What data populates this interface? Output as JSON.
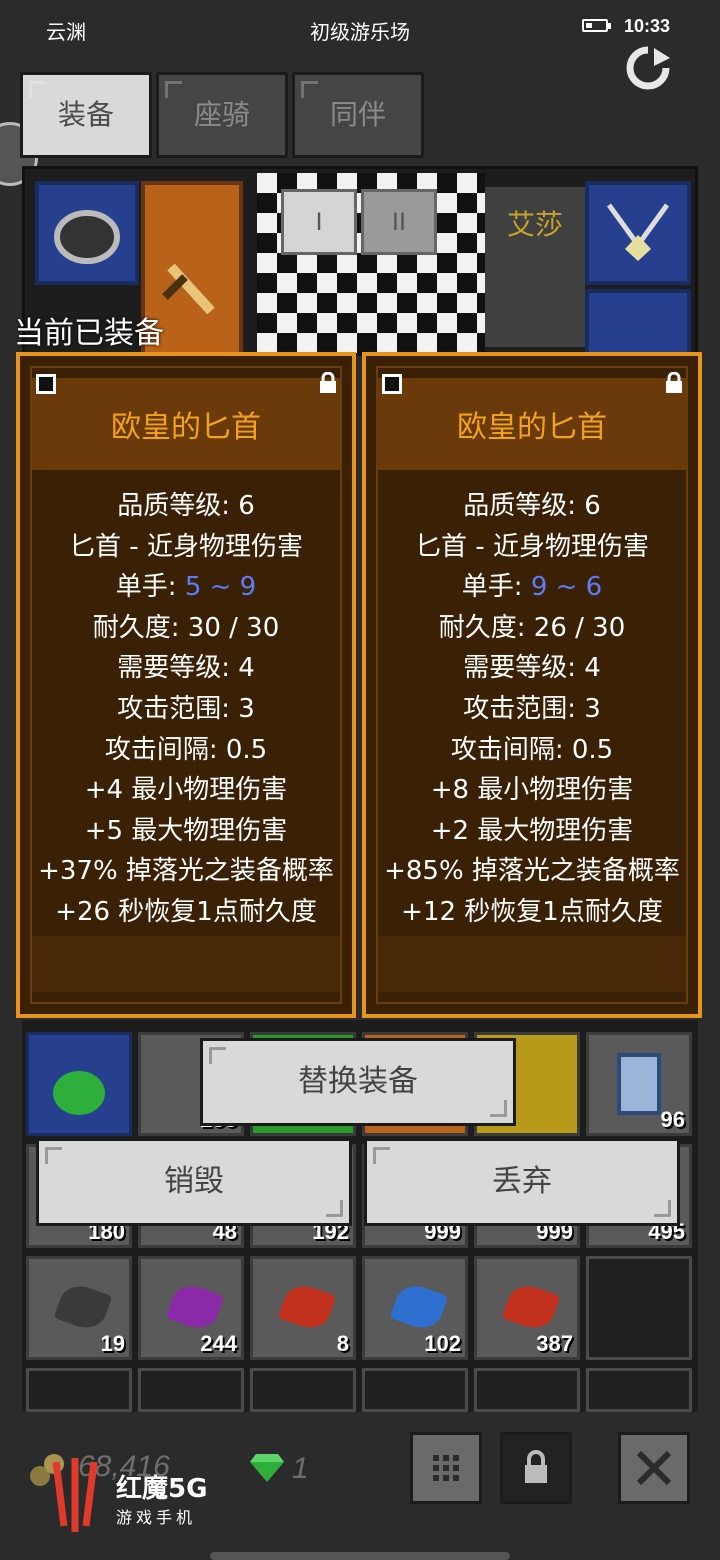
{
  "status_bar": {
    "left": "云渊",
    "center": "初级游乐场",
    "time": "10:33",
    "battery_level": 0.35
  },
  "tabs": [
    {
      "label": "装备",
      "active": true
    },
    {
      "label": "座骑",
      "active": false
    },
    {
      "label": "同伴",
      "active": false
    }
  ],
  "equip_panel": {
    "page_buttons": [
      "I",
      "II"
    ],
    "companion_name": "艾莎"
  },
  "current_equipped_label": "当前已装备",
  "cards": [
    {
      "title": "欧皇的匕首",
      "quality": "品质等级: 6",
      "type": "匕首 - 近身物理伤害",
      "hand_label": "单手: ",
      "hand_value": "5 ~ 9",
      "durability": "耐久度: 30 / 30",
      "required_level": "需要等级: 4",
      "attack_range": "攻击范围: 3",
      "attack_interval": "攻击间隔: 0.5",
      "bonuses": [
        "+4 最小物理伤害",
        "+5 最大物理伤害",
        "+37% 掉落光之装备概率",
        "+26 秒恢复1点耐久度"
      ]
    },
    {
      "title": "欧皇的匕首",
      "quality": "品质等级: 6",
      "type": "匕首 - 近身物理伤害",
      "hand_label": "单手: ",
      "hand_value": "9 ~ 6",
      "durability": "耐久度: 26 / 30",
      "required_level": "需要等级: 4",
      "attack_range": "攻击范围: 3",
      "attack_interval": "攻击间隔: 0.5",
      "bonuses": [
        "+8 最小物理伤害",
        "+2 最大物理伤害",
        "+85% 掉落光之装备概率",
        "+12 秒恢复1点耐久度"
      ]
    }
  ],
  "inventory": {
    "row1_counts": [
      "",
      "253",
      "",
      "",
      "",
      "96"
    ],
    "row2_counts": [
      "180",
      "48",
      "192",
      "999",
      "999",
      "495"
    ],
    "row3_counts": [
      "19",
      "244",
      "8",
      "102",
      "387",
      ""
    ],
    "leaf_colors": [
      "#3a3a3a",
      "#8a2aa8",
      "#c0301c",
      "#2f6fd0",
      "#c0301c"
    ]
  },
  "actions": {
    "replace": "替换装备",
    "destroy": "销毁",
    "discard": "丢弃"
  },
  "bottom_bar": {
    "gold": "68,416",
    "gems": "1",
    "brand_name": "红魔5G",
    "brand_sub": "游戏手机"
  },
  "colors": {
    "card_border": "#e7941c",
    "card_title": "#f3a21b",
    "bonus_text": "#5b7cf4",
    "card_bg": "#3a2106"
  }
}
